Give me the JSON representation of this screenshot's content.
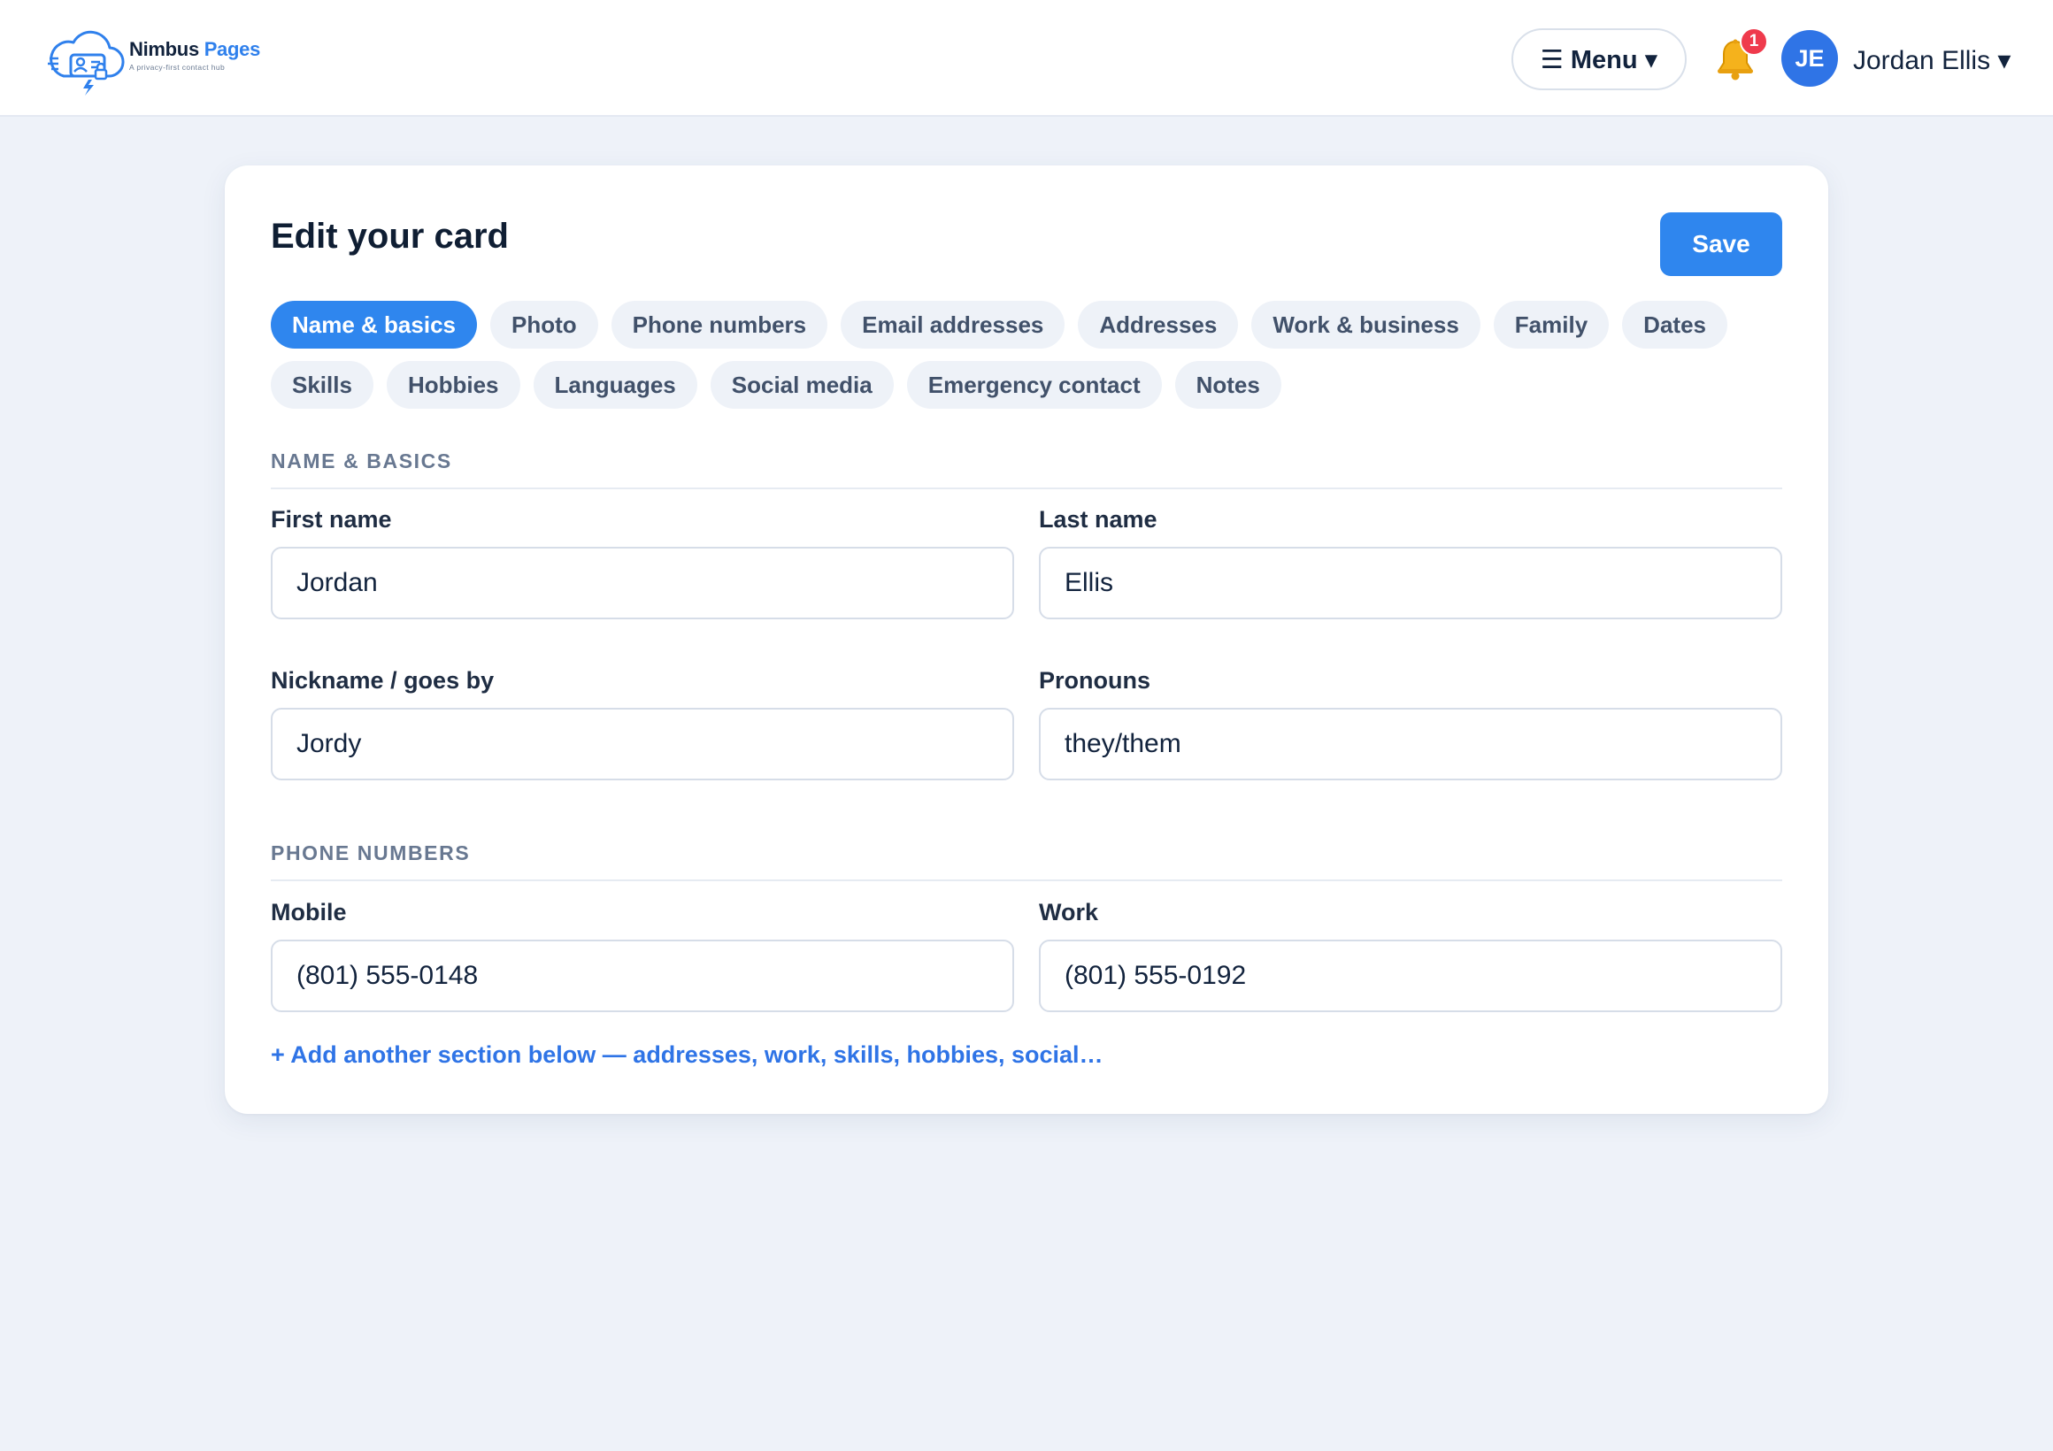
{
  "app": {
    "brand_name_1": "Nimbus",
    "brand_name_2": "Pages",
    "tagline": "A privacy-first contact hub"
  },
  "header": {
    "menu_label": "☰ Menu ▾",
    "notification_count": "1",
    "avatar_initials": "JE",
    "user_name": "Jordan Ellis ▾"
  },
  "card": {
    "title": "Edit your card",
    "save_label": "Save"
  },
  "tabs_row1": [
    {
      "label": "Name & basics",
      "active": true
    },
    {
      "label": "Photo"
    },
    {
      "label": "Phone numbers"
    },
    {
      "label": "Email addresses"
    },
    {
      "label": "Addresses"
    },
    {
      "label": "Work & business"
    },
    {
      "label": "Family"
    },
    {
      "label": "Dates"
    }
  ],
  "tabs_row2": [
    {
      "label": "Skills"
    },
    {
      "label": "Hobbies"
    },
    {
      "label": "Languages"
    },
    {
      "label": "Social media"
    },
    {
      "label": "Emergency contact"
    },
    {
      "label": "Notes"
    }
  ],
  "sections": {
    "name_basics": {
      "heading": "NAME & BASICS",
      "first_name_label": "First name",
      "first_name_value": "Jordan",
      "last_name_label": "Last name",
      "last_name_value": "Ellis",
      "nickname_label": "Nickname / goes by",
      "nickname_value": "Jordy",
      "pronouns_label": "Pronouns",
      "pronouns_value": "they/them"
    },
    "phone_numbers": {
      "heading": "PHONE NUMBERS",
      "mobile_label": "Mobile",
      "mobile_value": "(801) 555-0148",
      "work_label": "Work",
      "work_value": "(801) 555-0192"
    }
  },
  "add_section_link": "+ Add another section below — addresses, work, skills, hobbies, social…",
  "colors": {
    "accent": "#2f86ee",
    "page_bg": "#eef2f9",
    "badge": "#ef3a4c",
    "avatar": "#2f74e6"
  },
  "icons": {
    "logo": "cloud-contact-card-logo",
    "bell": "bell-icon"
  }
}
